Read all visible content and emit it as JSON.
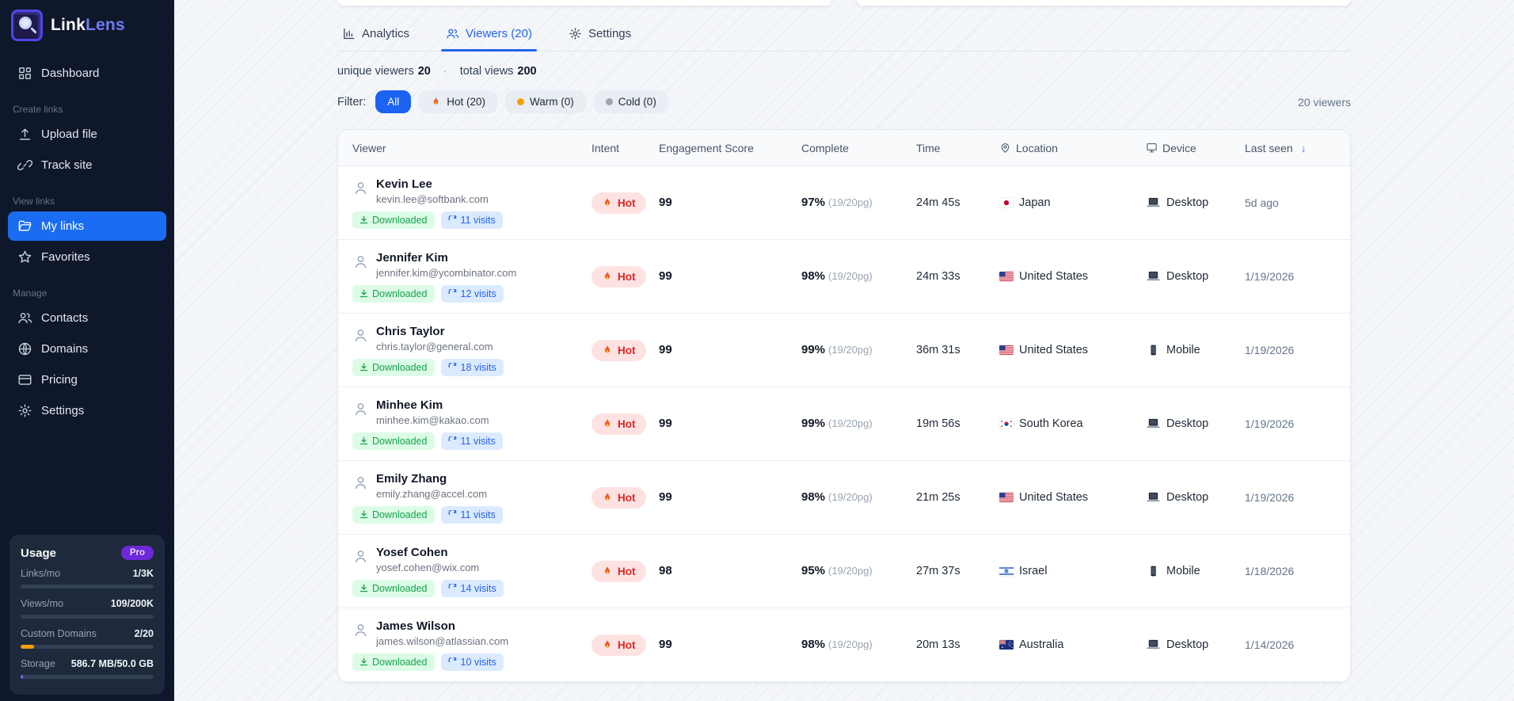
{
  "brand": {
    "first": "Link",
    "second": "Lens"
  },
  "sidebar": {
    "sections": {
      "create": "Create links",
      "view": "View links",
      "manage": "Manage"
    },
    "nav": [
      {
        "label": "Dashboard",
        "icon": "grid-icon"
      },
      {
        "label": "Upload file",
        "icon": "upload-icon"
      },
      {
        "label": "Track site",
        "icon": "link-icon"
      },
      {
        "label": "My links",
        "icon": "folder-icon",
        "active": true
      },
      {
        "label": "Favorites",
        "icon": "star-icon"
      },
      {
        "label": "Contacts",
        "icon": "users-icon"
      },
      {
        "label": "Domains",
        "icon": "globe-icon"
      },
      {
        "label": "Pricing",
        "icon": "credit-card-icon"
      },
      {
        "label": "Settings",
        "icon": "gear-icon"
      }
    ],
    "usage": {
      "title": "Usage",
      "plan_badge": "Pro",
      "meters": [
        {
          "label": "Links/mo",
          "value": "1/3K",
          "pct": 0,
          "color": "#64748b"
        },
        {
          "label": "Views/mo",
          "value": "109/200K",
          "pct": 0,
          "color": "#64748b"
        },
        {
          "label": "Custom Domains",
          "value": "2/20",
          "pct": 10,
          "color": "#f59e0b"
        },
        {
          "label": "Storage",
          "value": "586.7 MB/50.0 GB",
          "pct": 2,
          "color": "#8b5cf6"
        }
      ]
    }
  },
  "tabs": [
    {
      "label": "Analytics",
      "icon": "bar-chart-icon"
    },
    {
      "label": "Viewers (20)",
      "icon": "users-icon",
      "active": true
    },
    {
      "label": "Settings",
      "icon": "gear-icon"
    }
  ],
  "stats": {
    "unique_label": "unique viewers",
    "unique_value": "20",
    "separator": "·",
    "total_label": "total views",
    "total_value": "200"
  },
  "filters": {
    "label": "Filter:",
    "all": "All",
    "hot": "Hot (20)",
    "warm": "Warm (0)",
    "cold": "Cold (0)",
    "count": "20 viewers"
  },
  "colors": {
    "accent": "#2563eb",
    "active_nav": "#1a6df3",
    "hot": "#dc2626",
    "warm": "#f59e0b",
    "cold": "#9ca3af",
    "downloaded": "#16a34a",
    "pro": "#6d28d9",
    "storage": "#8b5cf6",
    "domains": "#f59e0b"
  },
  "table": {
    "columns": [
      "Viewer",
      "Intent",
      "Engagement Score",
      "Complete",
      "Time",
      "Location",
      "Device",
      "Last seen"
    ],
    "sort_indicator": "↓",
    "rows": [
      {
        "name": "Kevin Lee",
        "email": "kevin.lee@softbank.com",
        "downloaded_badge": "Downloaded",
        "visits_badge": "11 visits",
        "intent": "Hot",
        "score": "99",
        "complete": "97%",
        "pages": "(19/20pg)",
        "time": "24m 45s",
        "country": "Japan",
        "flag": "flag-japan",
        "device": "Desktop",
        "device_icon": "dev-desktop",
        "last_seen": "5d ago"
      },
      {
        "name": "Jennifer Kim",
        "email": "jennifer.kim@ycombinator.com",
        "downloaded_badge": "Downloaded",
        "visits_badge": "12 visits",
        "intent": "Hot",
        "score": "99",
        "complete": "98%",
        "pages": "(19/20pg)",
        "time": "24m 33s",
        "country": "United States",
        "flag": "flag-us",
        "device": "Desktop",
        "device_icon": "dev-desktop",
        "last_seen": "1/19/2026"
      },
      {
        "name": "Chris Taylor",
        "email": "chris.taylor@general.com",
        "downloaded_badge": "Downloaded",
        "visits_badge": "18 visits",
        "intent": "Hot",
        "score": "99",
        "complete": "99%",
        "pages": "(19/20pg)",
        "time": "36m 31s",
        "country": "United States",
        "flag": "flag-us",
        "device": "Mobile",
        "device_icon": "dev-mobile",
        "last_seen": "1/19/2026"
      },
      {
        "name": "Minhee Kim",
        "email": "minhee.kim@kakao.com",
        "downloaded_badge": "Downloaded",
        "visits_badge": "11 visits",
        "intent": "Hot",
        "score": "99",
        "complete": "99%",
        "pages": "(19/20pg)",
        "time": "19m 56s",
        "country": "South Korea",
        "flag": "flag-kr",
        "device": "Desktop",
        "device_icon": "dev-desktop",
        "last_seen": "1/19/2026"
      },
      {
        "name": "Emily Zhang",
        "email": "emily.zhang@accel.com",
        "downloaded_badge": "Downloaded",
        "visits_badge": "11 visits",
        "intent": "Hot",
        "score": "99",
        "complete": "98%",
        "pages": "(19/20pg)",
        "time": "21m 25s",
        "country": "United States",
        "flag": "flag-us",
        "device": "Desktop",
        "device_icon": "dev-desktop",
        "last_seen": "1/19/2026"
      },
      {
        "name": "Yosef Cohen",
        "email": "yosef.cohen@wix.com",
        "downloaded_badge": "Downloaded",
        "visits_badge": "14 visits",
        "intent": "Hot",
        "score": "98",
        "complete": "95%",
        "pages": "(19/20pg)",
        "time": "27m 37s",
        "country": "Israel",
        "flag": "flag-il",
        "device": "Mobile",
        "device_icon": "dev-mobile",
        "last_seen": "1/18/2026"
      },
      {
        "name": "James Wilson",
        "email": "james.wilson@atlassian.com",
        "downloaded_badge": "Downloaded",
        "visits_badge": "10 visits",
        "intent": "Hot",
        "score": "99",
        "complete": "98%",
        "pages": "(19/20pg)",
        "time": "20m 13s",
        "country": "Australia",
        "flag": "flag-au",
        "device": "Desktop",
        "device_icon": "dev-desktop",
        "last_seen": "1/14/2026"
      }
    ]
  }
}
